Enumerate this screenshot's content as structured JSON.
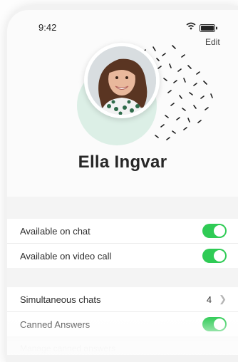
{
  "status_bar": {
    "time": "9:42"
  },
  "header": {
    "edit_label": "Edit"
  },
  "profile": {
    "name": "Ella Ingvar"
  },
  "availability": [
    {
      "label": "Available on chat",
      "enabled": true
    },
    {
      "label": "Available on video call",
      "enabled": true
    }
  ],
  "settings": {
    "simultaneous_chats": {
      "label": "Simultaneous chats",
      "value": "4"
    },
    "canned_answers": {
      "label": "Canned Answers",
      "enabled": true
    },
    "manage_canned_answers": {
      "label": "Manage canned answers"
    }
  },
  "colors": {
    "toggle_on": "#2fcb55",
    "accent_ring": "#dcefe6"
  }
}
